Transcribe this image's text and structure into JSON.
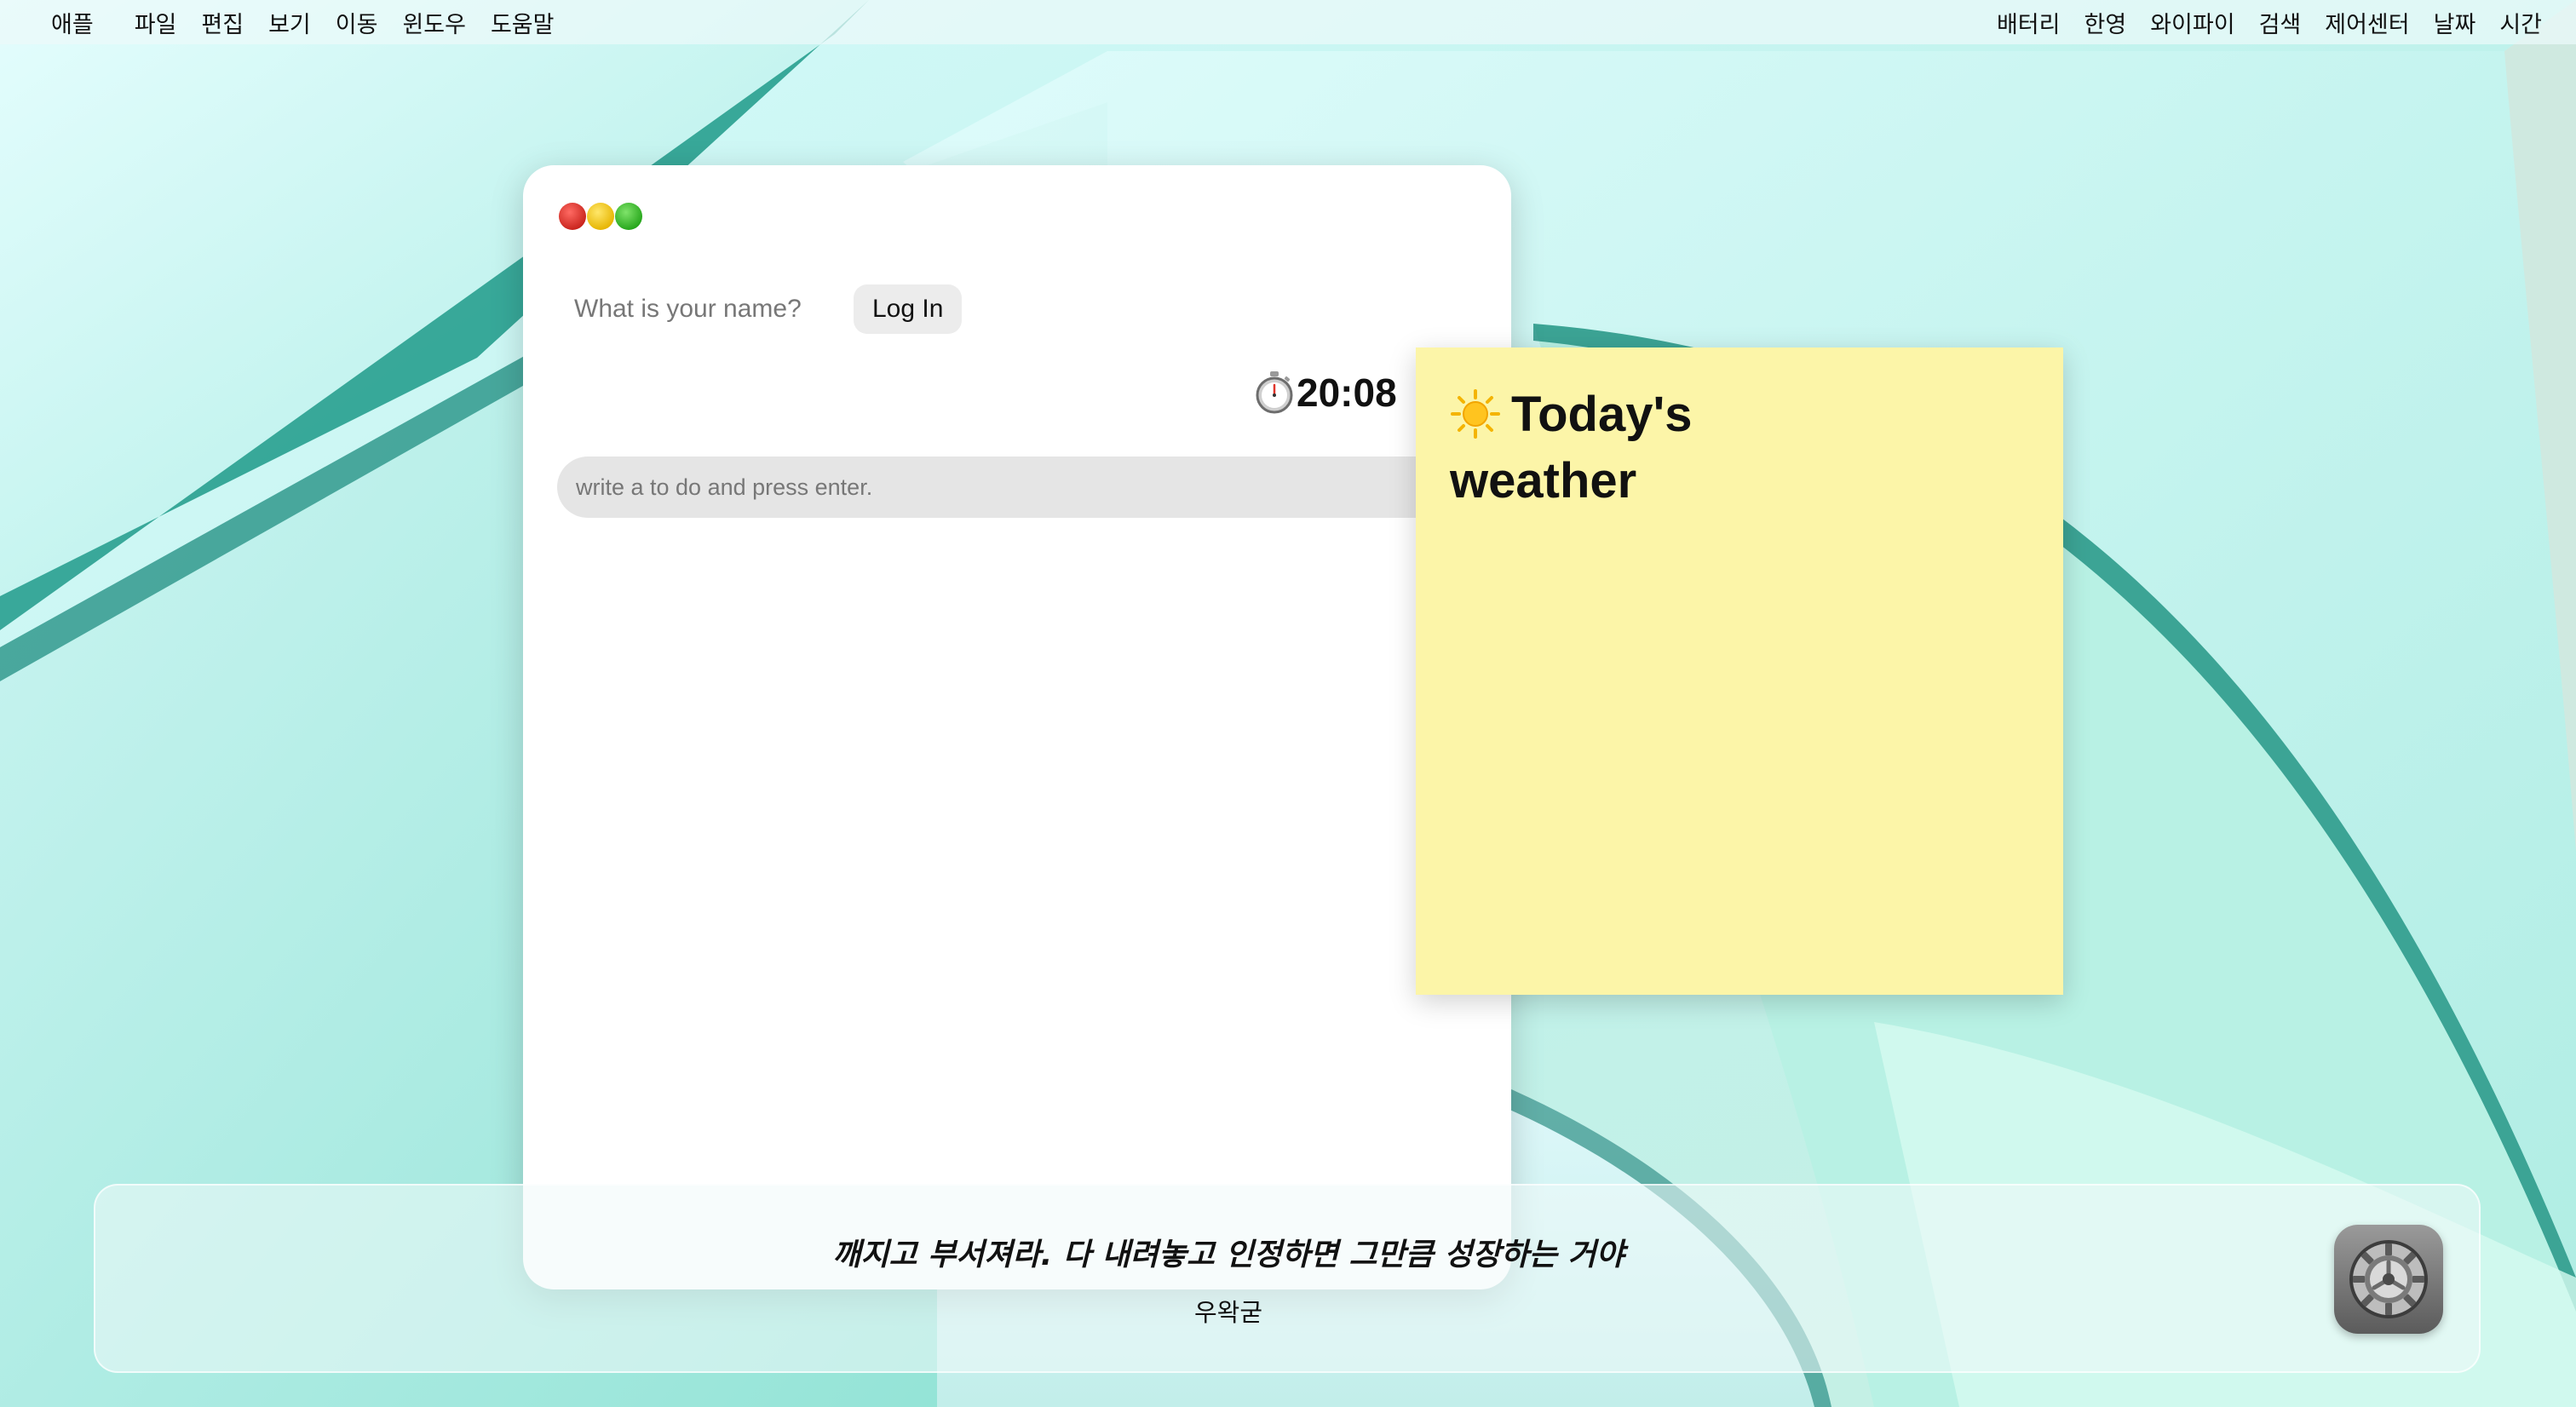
{
  "menubar": {
    "left": [
      "애플",
      "파일",
      "편집",
      "보기",
      "이동",
      "윈도우",
      "도움말"
    ],
    "right": [
      "배터리",
      "한영",
      "와이파이",
      "검색",
      "제어센터",
      "날짜",
      "시간"
    ]
  },
  "todo_window": {
    "name_placeholder": "What is your name?",
    "login_label": "Log In",
    "clock": "20:08",
    "todo_placeholder": "write a to do and press enter."
  },
  "sticky": {
    "title": "Today's weather",
    "icon": "sun-icon",
    "color": "#fcf5a8"
  },
  "dock": {
    "quote": "깨지고 부서져라. 다 내려놓고 인정하면 그만큼 성장하는 거야",
    "author": "우왁굳",
    "app_icon": "settings-gear-icon"
  },
  "colors": {
    "wallpaper_base": "#c9f1ec",
    "wallpaper_shadow": "#1e9a8a",
    "close": "#e0352b",
    "minimize": "#f5c51d",
    "zoom": "#3cc42c"
  }
}
